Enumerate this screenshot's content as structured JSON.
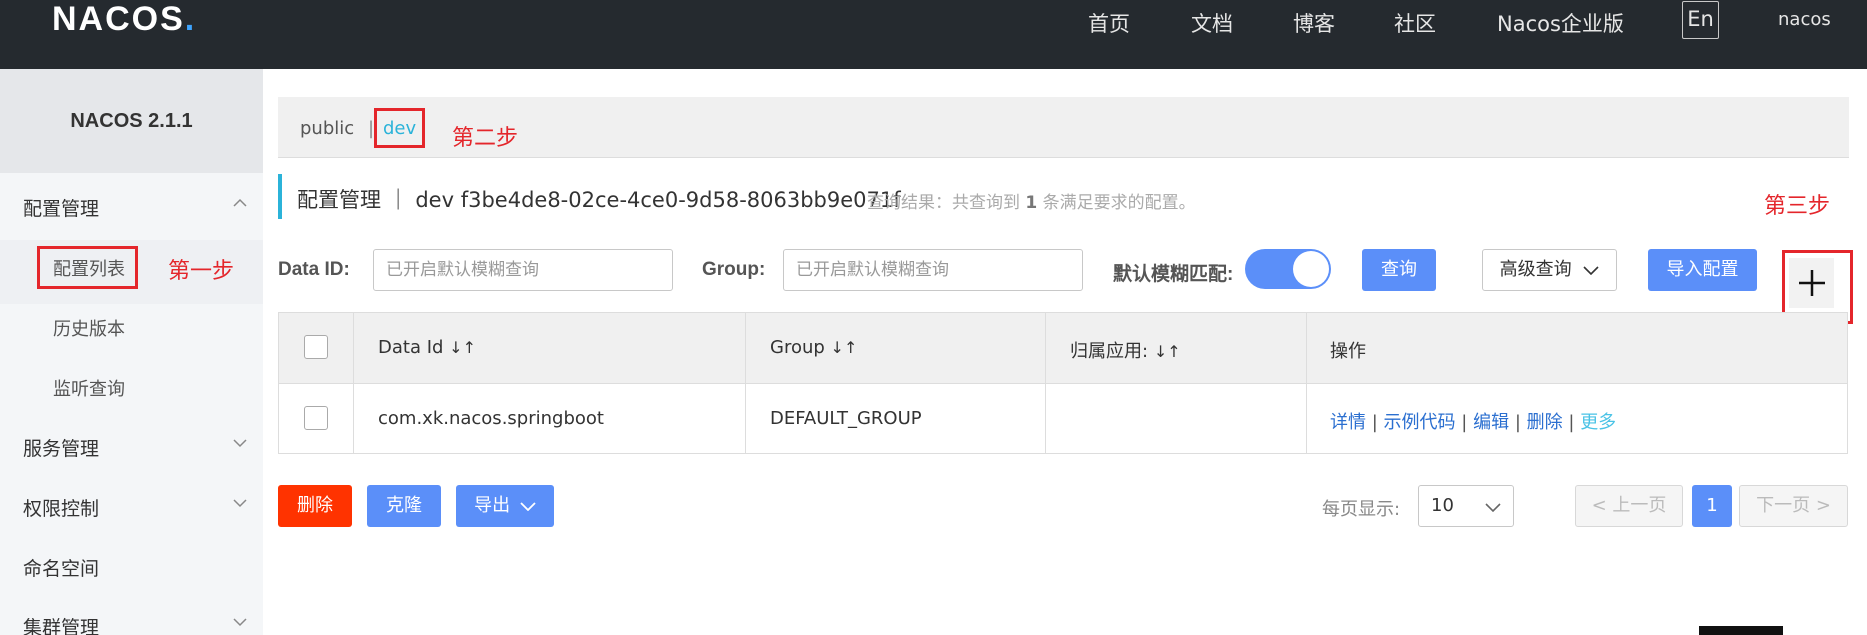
{
  "header": {
    "logo": "NACOS",
    "nav": [
      "首页",
      "文档",
      "博客",
      "社区",
      "Nacos企业版"
    ],
    "lang": "En",
    "user": "nacos"
  },
  "sidebar": {
    "version": "NACOS 2.1.1",
    "groups": [
      {
        "label": "配置管理",
        "expanded": true,
        "items": [
          "配置列表",
          "历史版本",
          "监听查询"
        ]
      },
      {
        "label": "服务管理",
        "expanded": false
      },
      {
        "label": "权限控制",
        "expanded": false
      },
      {
        "label": "命名空间"
      },
      {
        "label": "集群管理",
        "expanded": false
      }
    ]
  },
  "namespaces": {
    "items": [
      "public",
      "dev"
    ],
    "separator": "|",
    "active": "dev"
  },
  "annotations": {
    "step1": "第一步",
    "step2": "第二步",
    "step3": "第三步"
  },
  "title": {
    "text": "配置管理 ｜ dev  f3be4de8-02ce-4ce0-9d58-8063bb9e071f",
    "result_prefix": "查询结果：共查询到",
    "result_count": "1",
    "result_suffix": "条满足要求的配置。"
  },
  "search": {
    "data_id_label": "Data ID:",
    "data_id_placeholder": "已开启默认模糊查询",
    "group_label": "Group:",
    "group_placeholder": "已开启默认模糊查询",
    "fuzzy_label": "默认模糊匹配:",
    "fuzzy_enabled": true,
    "query_button": "查询",
    "advanced_button": "高级查询",
    "import_button": "导入配置",
    "add_button": "+"
  },
  "table": {
    "headers": [
      "Data Id",
      "Group",
      "归属应用:",
      "操作"
    ],
    "rows": [
      {
        "data_id": "com.xk.nacos.springboot",
        "group": "DEFAULT_GROUP",
        "app": "",
        "ops": [
          "详情",
          "示例代码",
          "编辑",
          "删除",
          "更多"
        ]
      }
    ]
  },
  "bottom": {
    "delete_button": "删除",
    "clone_button": "克隆",
    "export_button": "导出",
    "page_size_label": "每页显示:",
    "page_size": "10",
    "prev": "上一页",
    "current_page": "1",
    "next": "下一页"
  },
  "colors": {
    "accent": "#5b8ff9",
    "danger": "#ff3300",
    "annotation": "#e4262b",
    "topbar": "#252a2f"
  }
}
